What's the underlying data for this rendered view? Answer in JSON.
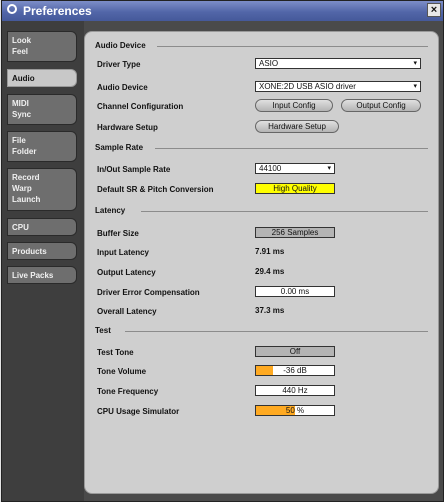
{
  "window": {
    "title": "Preferences",
    "close_glyph": "×"
  },
  "sidebar": {
    "tabs": [
      {
        "lines": [
          "Look",
          "Feel"
        ],
        "active": false
      },
      {
        "lines": [
          "Audio"
        ],
        "active": true
      },
      {
        "lines": [
          "MIDI",
          "Sync"
        ],
        "active": false
      },
      {
        "lines": [
          "File",
          "Folder"
        ],
        "active": false
      },
      {
        "lines": [
          "Record",
          "Warp",
          "Launch"
        ],
        "active": false
      },
      {
        "lines": [
          "CPU"
        ],
        "active": false
      },
      {
        "lines": [
          "Products"
        ],
        "active": false
      },
      {
        "lines": [
          "Live Packs"
        ],
        "active": false
      }
    ]
  },
  "audio_device": {
    "section": "Audio Device",
    "driver_type_label": "Driver Type",
    "driver_type_value": "ASIO",
    "audio_device_label": "Audio Device",
    "audio_device_value": "XONE:2D USB ASIO driver",
    "channel_config_label": "Channel Configuration",
    "input_config_button": "Input Config",
    "output_config_button": "Output Config",
    "hardware_setup_label": "Hardware Setup",
    "hardware_setup_button": "Hardware Setup"
  },
  "sample_rate": {
    "section": "Sample Rate",
    "rate_label": "In/Out Sample Rate",
    "rate_value": "44100",
    "conversion_label": "Default SR & Pitch Conversion",
    "conversion_value": "High Quality"
  },
  "latency": {
    "section": "Latency",
    "buffer_label": "Buffer Size",
    "buffer_value": "256 Samples",
    "input_label": "Input Latency",
    "input_value": "7.91 ms",
    "output_label": "Output Latency",
    "output_value": "29.4 ms",
    "driver_comp_label": "Driver Error Compensation",
    "driver_comp_value": "0.00 ms",
    "overall_label": "Overall Latency",
    "overall_value": "37.3 ms"
  },
  "test": {
    "section": "Test",
    "tone_label": "Test Tone",
    "tone_value": "Off",
    "volume_label": "Tone Volume",
    "volume_value": "-36 dB",
    "volume_fill_fraction": 0.22,
    "freq_label": "Tone Frequency",
    "freq_value": "440 Hz",
    "cpu_label": "CPU Usage Simulator",
    "cpu_value": "50 %",
    "cpu_fill_fraction": 0.5
  },
  "colors": {
    "highlight_yellow": "#ffff00",
    "meter_orange": "#ffaa22",
    "title_blue": "#5266a8"
  },
  "chooser_arrow_icon": "▾"
}
